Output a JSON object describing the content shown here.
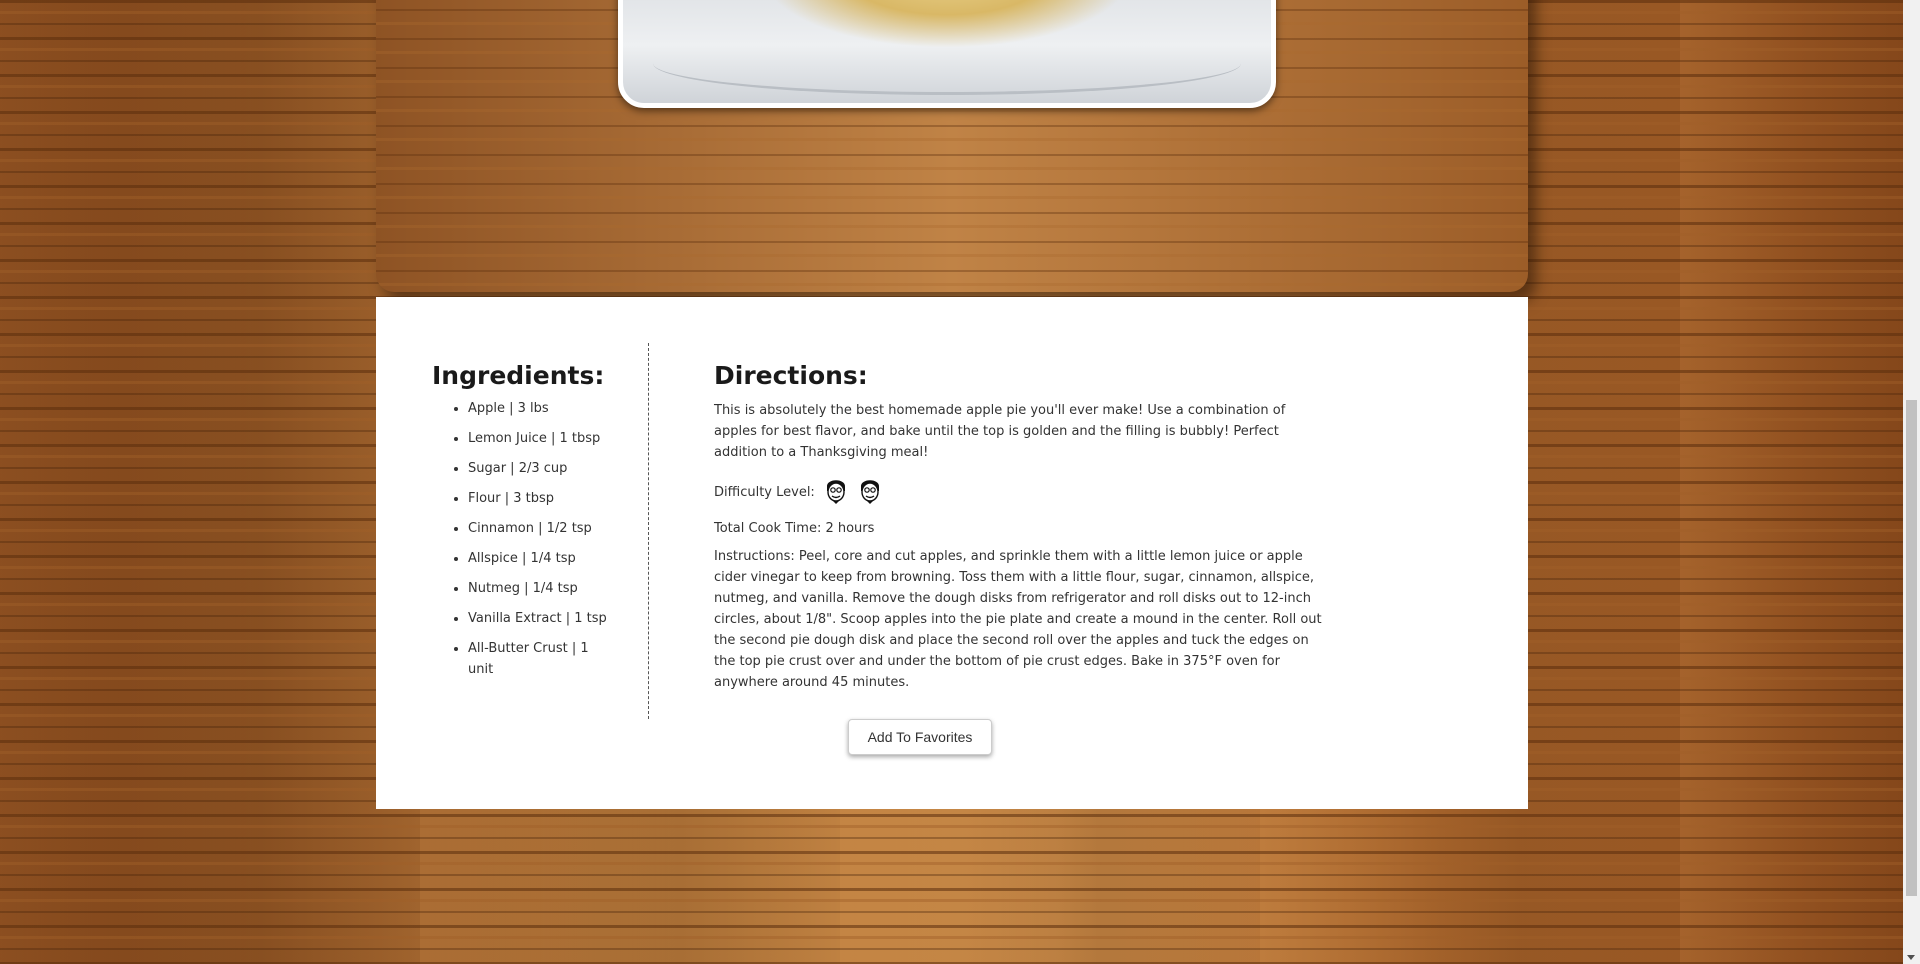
{
  "ingredients": {
    "heading": "Ingredients:",
    "items": [
      "Apple | 3 lbs",
      "Lemon Juice | 1 tbsp",
      "Sugar | 2/3 cup",
      "Flour | 3 tbsp",
      "Cinnamon | 1/2 tsp",
      "Allspice | 1/4 tsp",
      "Nutmeg | 1/4 tsp",
      "Vanilla Extract | 1 tsp",
      "All-Butter Crust | 1 unit"
    ]
  },
  "directions": {
    "heading": "Directions:",
    "description": "This is absolutely the best homemade apple pie you'll ever make! Use a combination of apples for best flavor, and bake until the top is golden and the filling is bubbly! Perfect addition to a Thanksgiving meal!",
    "difficulty_label": "Difficulty Level:",
    "difficulty_level": 2,
    "difficulty_icon": "chef-face-icon",
    "cook_time": "Total Cook Time: 2 hours",
    "instructions": "Instructions: Peel, core and cut apples, and sprinkle them with a little lemon juice or apple cider vinegar to keep from browning. Toss them with a little flour, sugar, cinnamon, allspice, nutmeg, and vanilla. Remove the dough disks from refrigerator and roll disks out to 12-inch circles, about 1/8\". Scoop apples into the pie plate and create a mound in the center. Roll out the second pie dough disk and place the second roll over the apples and tuck the edges on the top pie crust over and under the bottom of pie crust edges. Bake in 375°F oven for anywhere around 45 minutes."
  },
  "actions": {
    "favorites_label": "Add To Favorites"
  },
  "colors": {
    "card": "#ffffff",
    "text": "#333333",
    "wood": "#a6672e"
  }
}
